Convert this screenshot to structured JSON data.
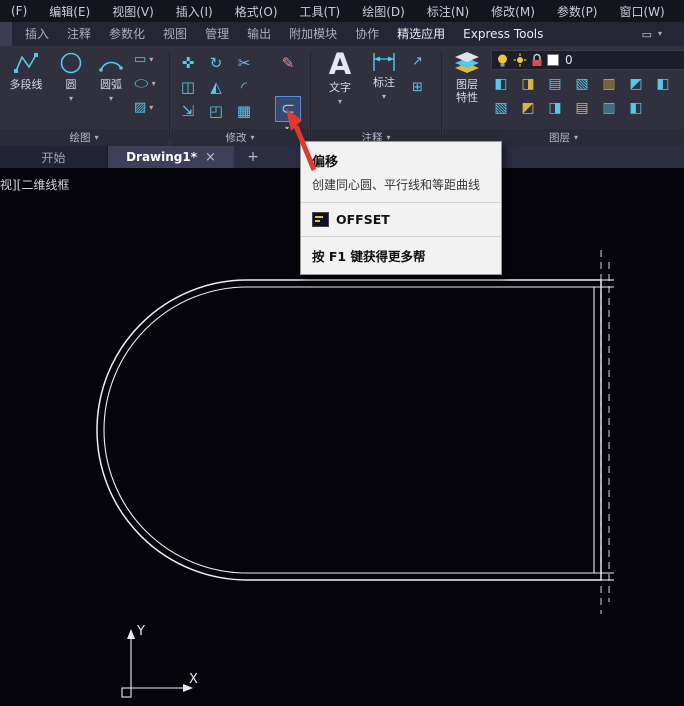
{
  "colors": {
    "accent_cyan": "#54c8e8",
    "accent_yellow": "#e0b73f",
    "arrow_red": "#e03a2f",
    "highlight_blue": "#5a8fd0"
  },
  "menu_bar": {
    "items": [
      "(F)",
      "编辑(E)",
      "视图(V)",
      "插入(I)",
      "格式(O)",
      "工具(T)",
      "绘图(D)",
      "标注(N)",
      "修改(M)",
      "参数(P)",
      "窗口(W)"
    ]
  },
  "ribbon_tabs": {
    "items": [
      "插入",
      "注释",
      "参数化",
      "视图",
      "管理",
      "输出",
      "附加模块",
      "协作",
      "精选应用",
      "Express Tools"
    ]
  },
  "ribbon": {
    "draw": {
      "label": "绘图",
      "polyline": "多段线",
      "circle": "圆",
      "arc": "圆弧"
    },
    "modify": {
      "label": "修改"
    },
    "annotate": {
      "label": "注释",
      "big_a": "A",
      "text": "文字",
      "dimension": "标注"
    },
    "layer": {
      "label": "图层",
      "properties": "图层特性",
      "current_layer": "0"
    }
  },
  "file_tabs": {
    "start": "开始",
    "active": "Drawing1*"
  },
  "tooltip": {
    "title": "偏移",
    "description": "创建同心圆、平行线和等距曲线",
    "command": "OFFSET",
    "help": "按 F1 键获得更多帮"
  },
  "canvas": {
    "viewport_label": "视][二维线框",
    "axis_x": "X",
    "axis_y": "Y"
  },
  "icons": {
    "caret": "▾",
    "close": "×",
    "plus": "+",
    "swatch": "■",
    "panel_toggle": "▭",
    "move": "✜",
    "rotate": "↻",
    "trim": "✂",
    "erase": "✎",
    "copy": "◫",
    "mirror": "◭",
    "fillet": "◜",
    "stretch": "⇲",
    "scale": "◰",
    "array": "▦",
    "offset": "⊂",
    "rect": "▭",
    "ellipse": "◯",
    "hatch": "▨",
    "leader": "↗",
    "table": "⊞",
    "layer_a": "◧",
    "layer_b": "◨",
    "layer_c": "▤",
    "layer_d": "▧",
    "layer_e": "▥",
    "layer_f": "◩"
  }
}
